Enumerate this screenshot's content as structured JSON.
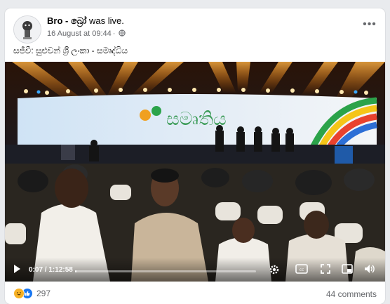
{
  "post": {
    "author": "Bro - බ්‍රෝ",
    "action": " was live.",
    "date": "16 August at 09:44",
    "privacy_icon": "globe-icon",
    "text": "සජීවී: සුළුවන් ශ්‍රී ලංකා - සමෘද්ධිය"
  },
  "video": {
    "current_time": "0:07",
    "duration": "1:12:58",
    "progress_fraction": 0.0016,
    "stage_text": "සමෘතිය",
    "controls": [
      "play-icon",
      "settings-icon",
      "captions-icon",
      "fullscreen-icon",
      "miniplayer-icon",
      "volume-icon"
    ]
  },
  "footer": {
    "reaction_count": "297",
    "comments": "44 comments"
  },
  "colors": {
    "stage_screen": "#dfe9f5",
    "light_orange": "#ff8a1a",
    "background": "#e9ebee"
  }
}
